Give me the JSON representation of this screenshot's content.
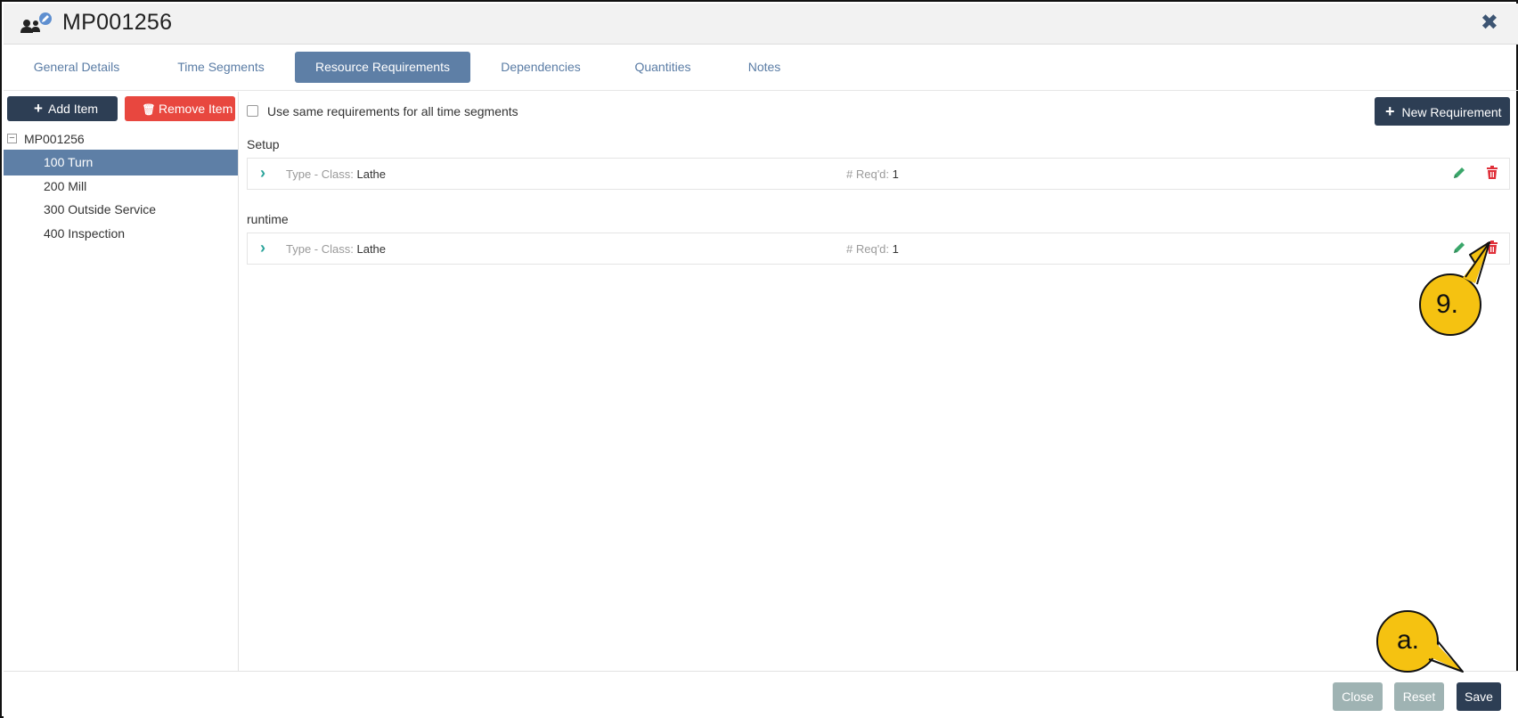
{
  "header": {
    "title": "MP001256",
    "close_glyph": "✖",
    "icon": "resource-edit-icon"
  },
  "tabs": [
    {
      "label": "General Details"
    },
    {
      "label": "Time Segments"
    },
    {
      "label": "Resource Requirements",
      "active": true
    },
    {
      "label": "Dependencies"
    },
    {
      "label": "Quantities"
    },
    {
      "label": "Notes"
    }
  ],
  "left": {
    "add_label": "Add Item",
    "remove_label": "Remove Item",
    "tree_root": "MP001256",
    "items": [
      {
        "label": "100 Turn",
        "selected": true
      },
      {
        "label": "200 Mill"
      },
      {
        "label": "300 Outside Service"
      },
      {
        "label": "400 Inspection"
      }
    ]
  },
  "main": {
    "same_req_label": "Use same requirements for all time segments",
    "same_req_checked": false,
    "new_req_label": "New Requirement",
    "segments": [
      {
        "label": "Setup",
        "type_key": "Type - Class:",
        "type_val": "Lathe",
        "qty_key": "# Req'd:",
        "qty_val": "1"
      },
      {
        "label": "runtime",
        "type_key": "Type - Class:",
        "type_val": "Lathe",
        "qty_key": "# Req'd:",
        "qty_val": "1"
      }
    ]
  },
  "footer": {
    "close_label": "Close",
    "reset_label": "Reset",
    "save_label": "Save"
  },
  "callouts": {
    "nine": "9.",
    "a": "a."
  },
  "colors": {
    "accent": "#5e7fa6",
    "dark": "#2d3e54",
    "danger": "#e8473f",
    "teal": "#2aa39a",
    "callout_fill": "#f5c211"
  }
}
